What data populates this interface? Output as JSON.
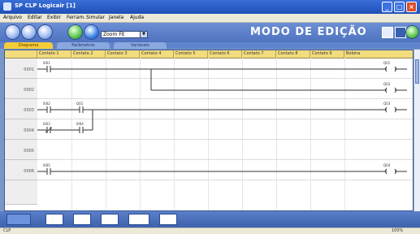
{
  "window": {
    "title": "SP CLP Logicair [1]"
  },
  "menu": [
    "Arquivo",
    "Editar",
    "Exibir",
    "Ferram.",
    "Simular",
    "Janela",
    "Ajuda"
  ],
  "toolbar": {
    "dropdown_value": "Zoom Fit",
    "mode_label": "MODO DE EDIÇÃO"
  },
  "tabs": [
    "Diagrama",
    "Parâmetros",
    "Variáveis"
  ],
  "grid": {
    "columns": [
      "Contato 1",
      "Contato 2",
      "Contato 3",
      "Contato 4",
      "Contato 5",
      "Contato 6",
      "Contato 7",
      "Contato 8",
      "Contato 9",
      "Bobina"
    ],
    "rows": [
      "0001",
      "0002",
      "0003",
      "0004",
      "0005",
      "0006"
    ]
  },
  "diagram": {
    "contacts": [
      "I001",
      "I002",
      "Q01",
      "I003",
      "I004",
      "I005"
    ],
    "coils": [
      "Q01",
      "Q02",
      "Q03",
      "Q04"
    ]
  },
  "status": {
    "left": "CLP",
    "right": "100%"
  }
}
